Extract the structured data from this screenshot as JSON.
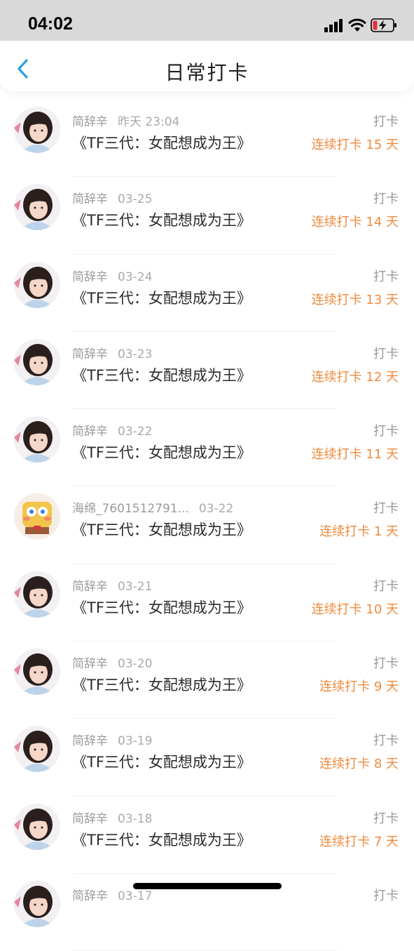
{
  "status_bar": {
    "time": "04:02"
  },
  "header": {
    "title": "日常打卡"
  },
  "rows": [
    {
      "name": "简辞辛",
      "date": "昨天 23:04",
      "book": "《TF三代：女配想成为王》",
      "action": "打卡",
      "streak": "连续打卡 15 天",
      "avatar": "girl"
    },
    {
      "name": "简辞辛",
      "date": "03-25",
      "book": "《TF三代：女配想成为王》",
      "action": "打卡",
      "streak": "连续打卡 14 天",
      "avatar": "girl"
    },
    {
      "name": "简辞辛",
      "date": "03-24",
      "book": "《TF三代：女配想成为王》",
      "action": "打卡",
      "streak": "连续打卡 13 天",
      "avatar": "girl"
    },
    {
      "name": "简辞辛",
      "date": "03-23",
      "book": "《TF三代：女配想成为王》",
      "action": "打卡",
      "streak": "连续打卡 12 天",
      "avatar": "girl"
    },
    {
      "name": "简辞辛",
      "date": "03-22",
      "book": "《TF三代：女配想成为王》",
      "action": "打卡",
      "streak": "连续打卡 11 天",
      "avatar": "girl"
    },
    {
      "name": "海绵_7601512791...",
      "date": "03-22",
      "book": "《TF三代：女配想成为王》",
      "action": "打卡",
      "streak": "连续打卡 1 天",
      "avatar": "sponge"
    },
    {
      "name": "简辞辛",
      "date": "03-21",
      "book": "《TF三代：女配想成为王》",
      "action": "打卡",
      "streak": "连续打卡 10 天",
      "avatar": "girl"
    },
    {
      "name": "简辞辛",
      "date": "03-20",
      "book": "《TF三代：女配想成为王》",
      "action": "打卡",
      "streak": "连续打卡 9 天",
      "avatar": "girl"
    },
    {
      "name": "简辞辛",
      "date": "03-19",
      "book": "《TF三代：女配想成为王》",
      "action": "打卡",
      "streak": "连续打卡 8 天",
      "avatar": "girl"
    },
    {
      "name": "简辞辛",
      "date": "03-18",
      "book": "《TF三代：女配想成为王》",
      "action": "打卡",
      "streak": "连续打卡 7 天",
      "avatar": "girl"
    },
    {
      "name": "简辞辛",
      "date": "03-17",
      "book": "",
      "action": "打卡",
      "streak": "",
      "avatar": "girl"
    }
  ]
}
